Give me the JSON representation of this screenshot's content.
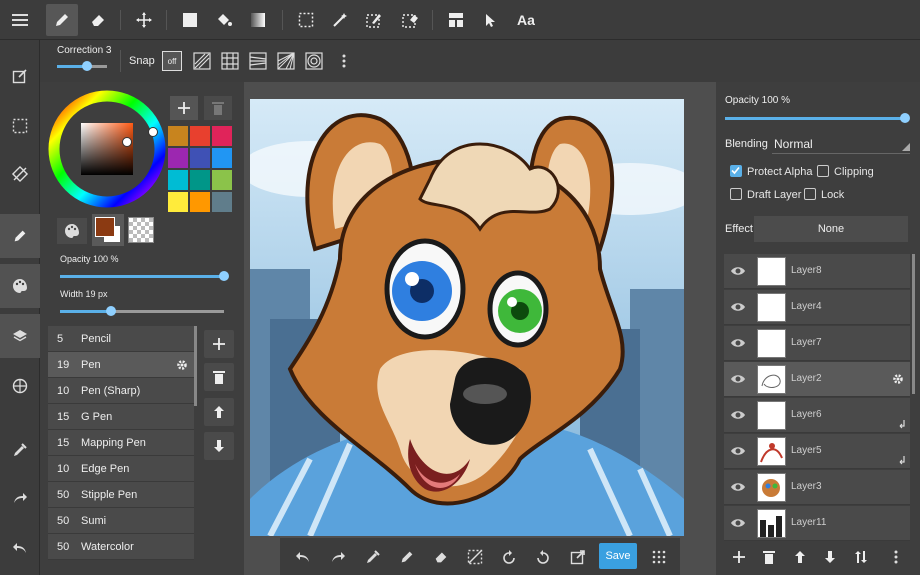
{
  "colors": {
    "accent": "#5ab0e8",
    "save": "#3aa0e0",
    "panel": "#3e3e3e",
    "primary_color": "#8b3a12"
  },
  "top_toolbar": {
    "icons": [
      "pen-icon",
      "eraser-icon",
      "move-icon",
      "fill-rect-icon",
      "bucket-icon",
      "gradient-icon",
      "select-rect-icon",
      "magic-wand-icon",
      "select-pen-icon",
      "select-eraser-icon",
      "frame-icon",
      "pointer-icon",
      "text-icon"
    ],
    "text_tool_label": "Aa"
  },
  "sub_bar": {
    "correction_label": "Correction 3",
    "correction_value": 3,
    "snap_label": "Snap",
    "snap_off_label": "off"
  },
  "color_panel": {
    "palette": [
      "#c8841e",
      "#e8402e",
      "#e0245a",
      "#9c27b0",
      "#3f51b5",
      "#2196f3",
      "#00bcd4",
      "#009688",
      "#8bc34a",
      "#ffeb3b",
      "#ff9800",
      "#607d8b"
    ],
    "opacity_label": "Opacity 100 %",
    "opacity_value": 100,
    "width_label": "Width 19 px",
    "width_value": 19
  },
  "brushes": [
    {
      "size": "5",
      "name": "Pencil"
    },
    {
      "size": "19",
      "name": "Pen"
    },
    {
      "size": "10",
      "name": "Pen (Sharp)"
    },
    {
      "size": "15",
      "name": "G Pen"
    },
    {
      "size": "15",
      "name": "Mapping Pen"
    },
    {
      "size": "10",
      "name": "Edge Pen"
    },
    {
      "size": "50",
      "name": "Stipple Pen"
    },
    {
      "size": "50",
      "name": "Sumi"
    },
    {
      "size": "50",
      "name": "Watercolor"
    }
  ],
  "bottom_bar": {
    "save_label": "Save"
  },
  "layer_panel": {
    "opacity_label": "Opacity 100 %",
    "opacity_value": 100,
    "blending_label": "Blending",
    "blending_value": "Normal",
    "protect_alpha_label": "Protect Alpha",
    "protect_alpha_checked": true,
    "clipping_label": "Clipping",
    "clipping_checked": false,
    "draft_label": "Draft Layer",
    "draft_checked": false,
    "lock_label": "Lock",
    "lock_checked": false,
    "effect_label": "Effect",
    "effect_value": "None",
    "layers": [
      {
        "name": "Layer8"
      },
      {
        "name": "Layer4"
      },
      {
        "name": "Layer7"
      },
      {
        "name": "Layer2"
      },
      {
        "name": "Layer6"
      },
      {
        "name": "Layer5"
      },
      {
        "name": "Layer3"
      },
      {
        "name": "Layer11"
      }
    ]
  }
}
